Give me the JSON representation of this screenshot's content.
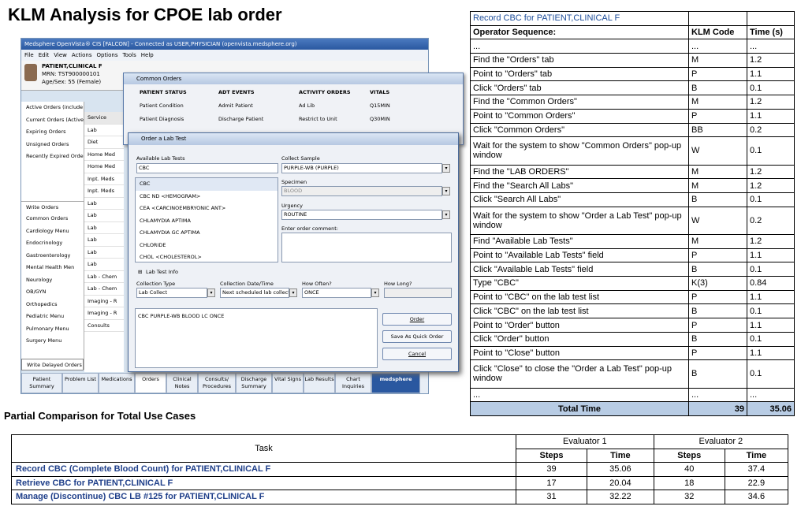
{
  "title": "KLM Analysis for CPOE lab order",
  "screenshot": {
    "app_title": "Medsphere OpenVista® CIS [FALCON] - Connected as USER,PHYSICIAN (openvista.medsphere.org)",
    "menu": [
      "File",
      "Edit",
      "View",
      "Actions",
      "Options",
      "Tools",
      "Help"
    ],
    "patient": {
      "name": "PATIENT,CLINICAL F",
      "mrn": "MRN: TST900000101",
      "age": "Age/Sex: 55 (Female)"
    },
    "left_items": [
      "Active Orders (include",
      "Current Orders (Active",
      "Expiring Orders",
      "Unsigned Orders",
      "Recently Expired Orde"
    ],
    "write_orders": "Write Orders",
    "write_items": [
      "Common Orders",
      "Cardiology Menu",
      "Endocrinology",
      "Gastroenterology",
      "Mental Health Men",
      "Neurology",
      "OB/GYN",
      "Orthopedics",
      "Pediatric Menu",
      "Pulmonary Menu",
      "Surgery Menu"
    ],
    "write_delayed": "Write Delayed Orders",
    "service_header": "Service",
    "service_items": [
      "Lab",
      "Diet",
      "Home Med",
      "Home Med",
      "Inpt. Meds",
      "Inpt. Meds",
      "Lab",
      "Lab",
      "Lab",
      "Lab",
      "Lab",
      "Lab",
      "Lab - Chem",
      "Lab - Chem",
      "Imaging - R",
      "Imaging - R",
      "Consults"
    ],
    "tabs": [
      "Patient Summary",
      "Problem List",
      "Medications",
      "Orders",
      "Clinical Notes",
      "Consults/ Procedures",
      "Discharge Summary",
      "Vital Signs",
      "Lab Results",
      "Chart Inquiries",
      "medsphere"
    ]
  },
  "common_orders": {
    "title": "Common Orders",
    "headers": [
      "PATIENT STATUS",
      "ADT EVENTS",
      "ACTIVITY ORDERS",
      "VITALS"
    ],
    "row1": [
      "Patient Condition",
      "Admit Patient",
      "Ad Lib",
      "Q15MIN"
    ],
    "row2": [
      "Patient Diagnosis",
      "Discharge Patient",
      "Restrict to Unit",
      "Q30MIN"
    ]
  },
  "lab_order": {
    "title": "Order a Lab Test",
    "available_label": "Available Lab Tests",
    "available_value": "CBC",
    "list": [
      "CBC",
      "CBC ND    <HEMOGRAM>",
      "CEA    <CARCINOEMBRYONIC ANT>",
      "CHLAMYDIA APTIMA",
      "CHLAMYDIA GC APTIMA",
      "CHLORIDE",
      "CHOL       <CHOLESTEROL>"
    ],
    "collect_label": "Collect Sample",
    "collect_value": "PURPLE-WB (PURPLE)",
    "specimen_label": "Specimen",
    "specimen_value": "BLOOD",
    "urgency_label": "Urgency",
    "urgency_value": "ROUTINE",
    "comment_label": "Enter order comment:",
    "lab_test_info": "Lab Test Info",
    "collection_type_label": "Collection Type",
    "collection_type_value": "Lab Collect",
    "collection_date_label": "Collection Date/Time",
    "collection_date_value": "Next scheduled lab collect",
    "how_often_label": "How Often?",
    "how_often_value": "ONCE",
    "how_long_label": "How Long?",
    "summary": "CBC PURPLE-WB BLOOD  LC ONCE",
    "order_btn": "Order",
    "quick_btn": "Save As Quick Order",
    "cancel_btn": "Cancel"
  },
  "klm": {
    "caption": "Record CBC for PATIENT,CLINICAL F",
    "headers": [
      "Operator Sequence:",
      "KLM Code",
      "Time (s)"
    ],
    "rows": [
      [
        "...",
        "...",
        "..."
      ],
      [
        "Find the \"Orders\" tab",
        "M",
        "1.2"
      ],
      [
        "Point to \"Orders\" tab",
        "P",
        "1.1"
      ],
      [
        "Click \"Orders\" tab",
        "B",
        "0.1"
      ],
      [
        "Find the \"Common Orders\"",
        "M",
        "1.2"
      ],
      [
        "Point to \"Common Orders\"",
        "P",
        "1.1"
      ],
      [
        "Click \"Common Orders\"",
        "BB",
        "0.2"
      ],
      [
        "Wait for the system to show \"Common Orders\" pop-up window",
        "W",
        "0.1"
      ],
      [
        "Find the \"LAB ORDERS\"",
        "M",
        "1.2"
      ],
      [
        "Find the \"Search All Labs\"",
        "M",
        "1.2"
      ],
      [
        "Click \"Search All Labs\"",
        "B",
        "0.1"
      ],
      [
        "Wait for the system to show \"Order a Lab Test\" pop-up window",
        "W",
        "0.2"
      ],
      [
        "Find \"Available Lab Tests\"",
        "M",
        "1.2"
      ],
      [
        "Point to \"Available Lab Tests\" field",
        "P",
        "1.1"
      ],
      [
        "Click  \"Available Lab Tests\" field",
        "B",
        "0.1"
      ],
      [
        "Type \"CBC\"",
        "K(3)",
        "0.84"
      ],
      [
        "Point to \"CBC\" on the lab test list",
        "P",
        "1.1"
      ],
      [
        "Click \"CBC\" on the lab test list",
        "B",
        "0.1"
      ],
      [
        "Point to \"Order\" button",
        "P",
        "1.1"
      ],
      [
        "Click \"Order\" button",
        "B",
        "0.1"
      ],
      [
        "Point to \"Close\" button",
        "P",
        "1.1"
      ],
      [
        "Click \"Close\" to close the \"Order a Lab Test\" pop-up window",
        "B",
        "0.1"
      ],
      [
        "...",
        "...",
        "..."
      ]
    ],
    "total_label": "Total Time",
    "total_steps": "39",
    "total_time": "35.06"
  },
  "comparison": {
    "title": "Partial Comparison for Total Use Cases",
    "task_header": "Task",
    "eval1": "Evaluator 1",
    "eval2": "Evaluator 2",
    "steps": "Steps",
    "time": "Time",
    "rows": [
      [
        "Record CBC (Complete Blood Count) for PATIENT,CLINICAL F",
        "39",
        "35.06",
        "40",
        "37.4"
      ],
      [
        "Retrieve CBC for PATIENT,CLINICAL F",
        "17",
        "20.04",
        "18",
        "22.9"
      ],
      [
        "Manage (Discontinue) CBC LB #125 for PATIENT,CLINICAL F",
        "31",
        "32.22",
        "32",
        "34.6"
      ]
    ]
  }
}
